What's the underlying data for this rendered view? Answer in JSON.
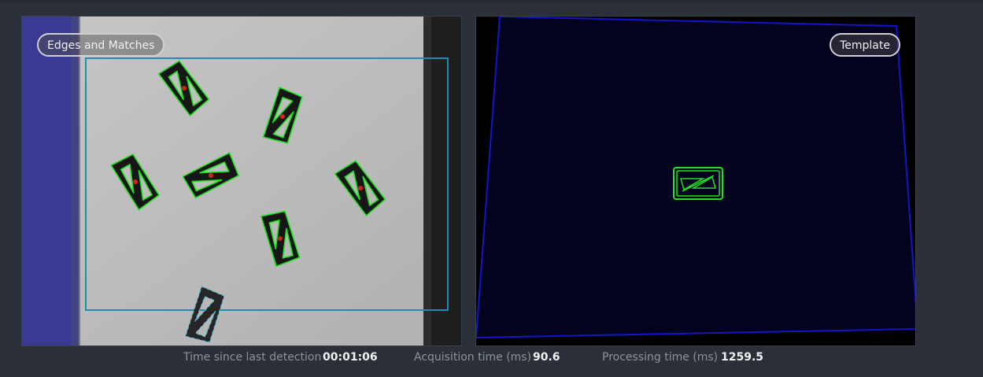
{
  "left_panel": {
    "label": "Edges and Matches",
    "colors": {
      "match_edge": "#1fe01f",
      "center_mark": "#d81e1e",
      "roi": "#1b8fb0",
      "mask": "#3a3a9a"
    }
  },
  "right_panel": {
    "label": "Template",
    "colors": {
      "quad": "#1515c8",
      "template_edge": "#22e022"
    }
  },
  "stats": {
    "time_since_label": "Time since last detection",
    "time_since_value": "00:01:06",
    "acq_label": "Acquisition time (ms)",
    "acq_value": "90.6",
    "proc_label": "Processing time (ms)",
    "proc_value": "1259.5"
  }
}
